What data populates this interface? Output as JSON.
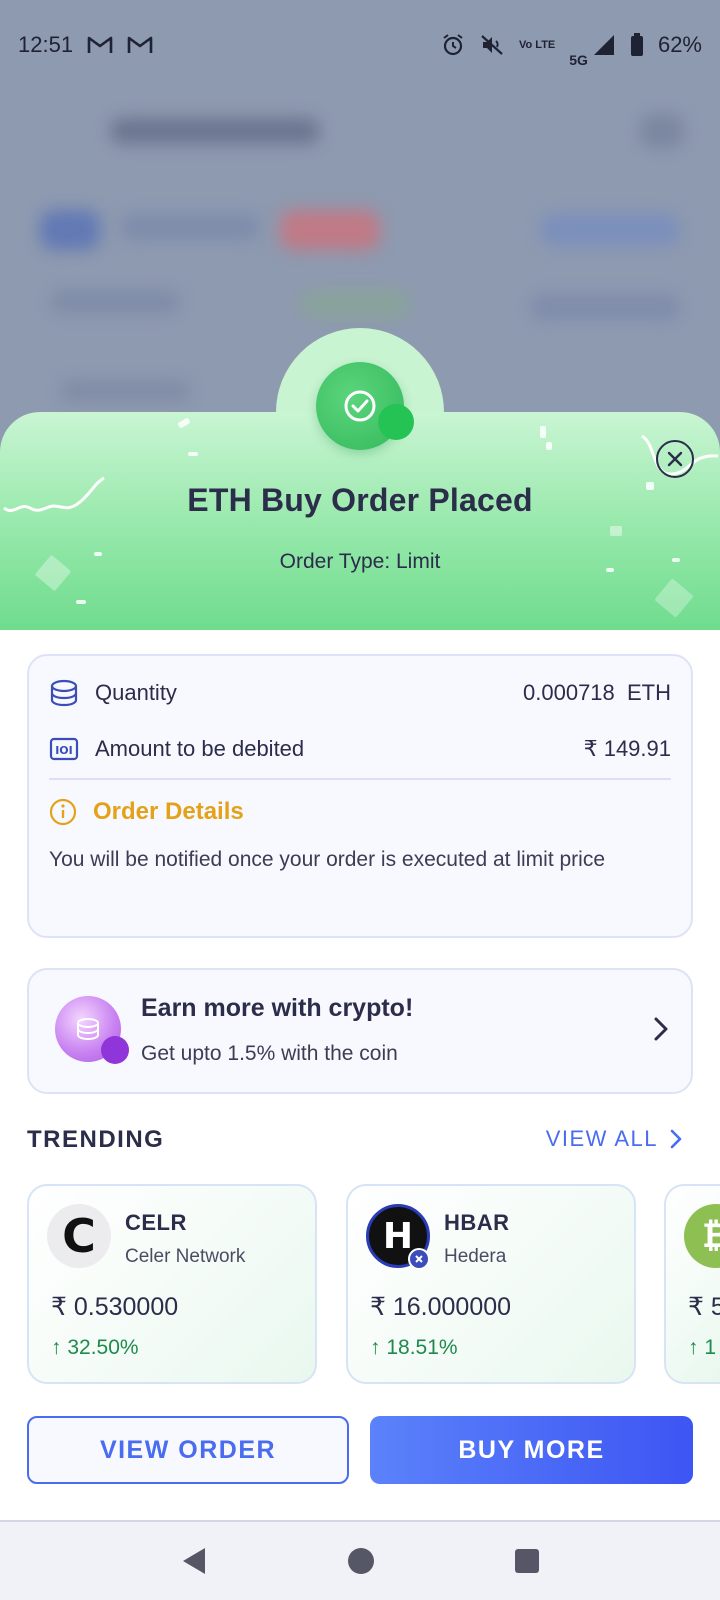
{
  "status_bar": {
    "time": "12:51",
    "battery": "62%",
    "network": "5G",
    "volte": "Vo LTE"
  },
  "hero": {
    "title": "ETH Buy Order Placed",
    "subtitle": "Order Type: Limit"
  },
  "order": {
    "quantity_label": "Quantity",
    "quantity_value": "0.000718  ETH",
    "amount_label": "Amount to be debited",
    "amount_value": "₹ 149.91",
    "details_title": "Order Details",
    "details_text": "You will be notified once your order is executed at limit price"
  },
  "earn": {
    "title": "Earn more with crypto!",
    "subtitle": "Get upto 1.5% with the coin"
  },
  "trending": {
    "title": "TRENDING",
    "view_all": "VIEW ALL",
    "items": [
      {
        "symbol": "CELR",
        "name": "Celer Network",
        "price": "₹ 0.530000",
        "change": "↑ 32.50%"
      },
      {
        "symbol": "HBAR",
        "name": "Hedera",
        "price": "₹ 16.000000",
        "change": "↑ 18.51%"
      },
      {
        "symbol": "",
        "name": "",
        "price": "₹ 5",
        "change": "↑ 1"
      }
    ]
  },
  "actions": {
    "view_order": "VIEW ORDER",
    "buy_more": "BUY MORE"
  },
  "colors": {
    "accent": "#4a6cf0",
    "success": "#1f8a4c",
    "warning": "#e3a21a",
    "hero_green": "#6fdc8e"
  }
}
